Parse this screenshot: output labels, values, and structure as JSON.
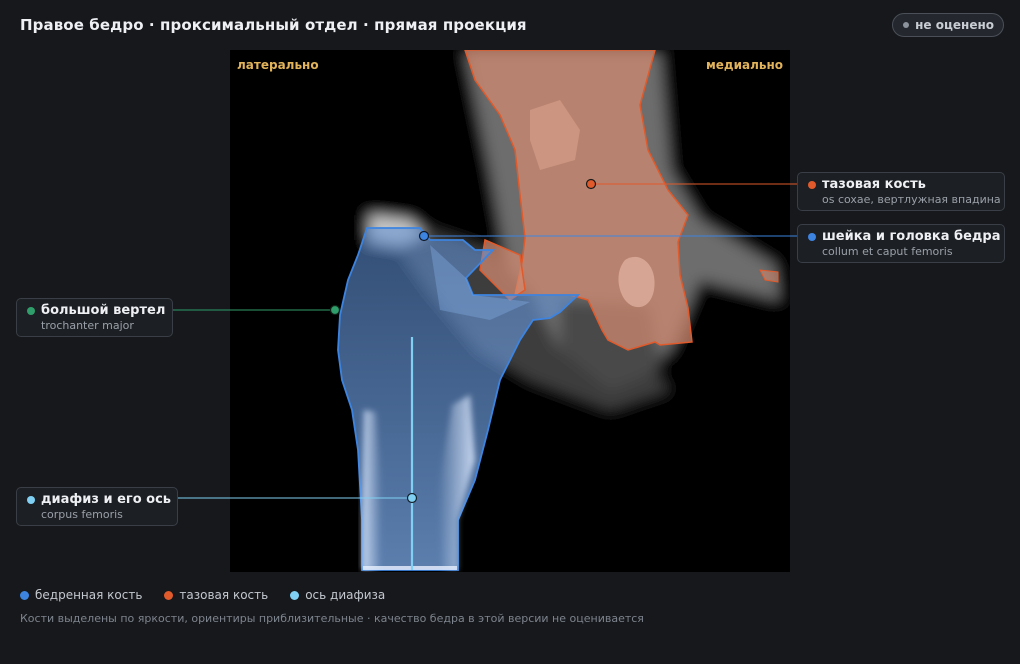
{
  "header": {
    "title": "Правое бедро · проксимальный отдел · прямая проекция",
    "status": "не оценено"
  },
  "viewer": {
    "orient_left": "латерально",
    "orient_right": "медиально"
  },
  "callouts": {
    "pelvis": {
      "name": "тазовая кость",
      "latin": "os coxae, вертлужная впадина",
      "color": "#e05a2b"
    },
    "neck": {
      "name": "шейка и головка бедра",
      "latin": "collum et caput femoris",
      "color": "#3d84e0"
    },
    "trochanter": {
      "name": "большой вертел",
      "latin": "trochanter major",
      "color": "#2f9e6a"
    },
    "shaft": {
      "name": "диафиз и его ось",
      "latin": "corpus femoris",
      "color": "#7fd0f2"
    }
  },
  "legend": [
    {
      "label": "бедренная кость",
      "color": "#3d84e0"
    },
    {
      "label": "тазовая кость",
      "color": "#e05a2b"
    },
    {
      "label": "ось диафиза",
      "color": "#7fd0f2"
    }
  ],
  "footnote": "Кости выделены по яркости, ориентиры приблизительные · качество бедра в этой версии не оценивается"
}
